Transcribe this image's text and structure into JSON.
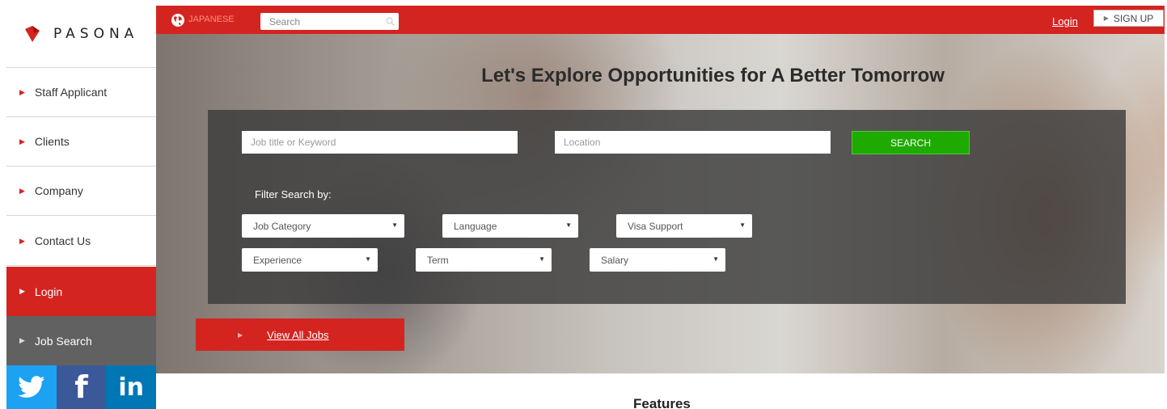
{
  "brand": {
    "name": "PASONA",
    "color": "#d42420"
  },
  "sidebar": {
    "items": [
      {
        "label": "Staff Applicant",
        "state": "default"
      },
      {
        "label": "Clients",
        "state": "default"
      },
      {
        "label": "Company",
        "state": "default"
      },
      {
        "label": "Contact Us",
        "state": "default"
      },
      {
        "label": "Login",
        "state": "active-red"
      },
      {
        "label": "Job Search",
        "state": "active-gray"
      }
    ],
    "social": [
      {
        "icon": "twitter-icon",
        "color": "#1da1f2"
      },
      {
        "icon": "facebook-icon",
        "label": "f",
        "color": "#3b5998"
      },
      {
        "icon": "linkedin-icon",
        "label": "in",
        "color": "#0077b5"
      }
    ]
  },
  "topbar": {
    "language": "JAPANESE",
    "search_placeholder": "Search",
    "login_label": "Login",
    "signup_label": "SIGN UP"
  },
  "hero": {
    "headline": "Let's Explore Opportunities for A Better Tomorrow",
    "keyword_placeholder": "Job title or Keyword",
    "location_placeholder": "Location",
    "search_button": "SEARCH",
    "filter_label": "Filter Search by:",
    "filters": [
      "Job Category",
      "Language",
      "Visa Support",
      "Experience",
      "Term",
      "Salary"
    ],
    "view_all": "View All Jobs"
  },
  "features_heading": "Features",
  "colors": {
    "accent_red": "#d42420",
    "search_green": "#1faa00",
    "panel_gray": "#3c3c3c"
  }
}
